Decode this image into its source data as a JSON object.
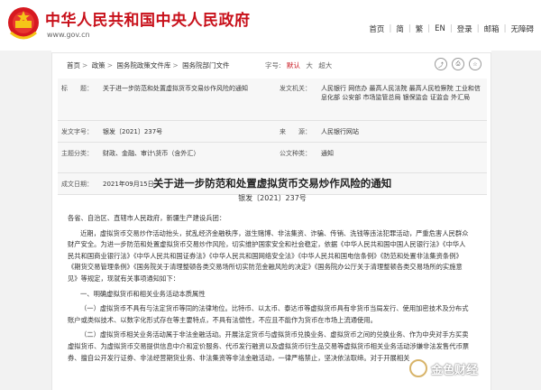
{
  "header": {
    "site_title": "中华人民共和国中央人民政府",
    "site_url": "www.gov.cn",
    "nav": [
      "首页",
      "简",
      "繁",
      "EN",
      "登录",
      "邮箱",
      "无障碍"
    ],
    "colors": {
      "brand": "#c8101a",
      "side_bg": "#f2f2f2"
    }
  },
  "breadcrumb": [
    "首页",
    "政策",
    "国务院政策文件库",
    "国务院部门文件"
  ],
  "font_size": {
    "label": "字号:",
    "options": [
      "默认",
      "大",
      "超大"
    ],
    "selected": "默认"
  },
  "toolbar_icons": [
    "share-icon",
    "print-icon",
    "favorite-icon"
  ],
  "meta": {
    "title_label": "标　　题：",
    "title": "关于进一步防范和处置虚拟货币交易炒作风险的通知",
    "issuer_label": "发文机关：",
    "issuer": "人民银行 网信办 最高人民法院 最高人民检察院 工业和信息化部 公安部 市场监管总局 银保监会 证监会 外汇局",
    "doc_no_label": "发文字号：",
    "doc_no": "银发〔2021〕237号",
    "source_label": "来　　源：",
    "source": "人民银行网站",
    "category_label": "主题分类：",
    "category": "财政、金融、审计\\货币（含外汇）",
    "type_label": "公文种类：",
    "type": "通知",
    "date_label": "成文日期：",
    "date": "2021年09月15日"
  },
  "doc": {
    "title": "关于进一步防范和处置虚拟货币交易炒作风险的通知",
    "number": "银发〔2021〕237号",
    "salutation": "各省、自治区、直辖市人民政府，新疆生产建设兵团：",
    "para1": "近期，虚拟货币交易炒作活动抬头，扰乱经济金融秩序，滋生赌博、非法集资、诈骗、传销、洗钱等违法犯罪活动，严重危害人民群众财产安全。为进一步防范和处置虚拟货币交易炒作风险，切实维护国家安全和社会稳定，依据《中华人民共和国中国人民银行法》《中华人民共和国商业银行法》《中华人民共和国证券法》《中华人民共和国网络安全法》《中华人民共和国电信条例》《防范和处置非法集资条例》《期货交易管理条例》《国务院关于清理整顿各类交易场所切实防范金融风险的决定》《国务院办公厅关于清理整顿各类交易场所的实施意见》等规定，现就有关事项通知如下：",
    "section1": "一、明确虚拟货币和相关业务活动本质属性",
    "para2": "（一）虚拟货币不具有与法定货币等同的法律地位。比特币、以太币、泰达币等虚拟货币具有非货币当局发行、使用加密技术及分布式账户或类似技术、以数字化形式存在等主要特点，不具有法偿性，不应且不能作为货币在市场上流通使用。",
    "para3": "（二）虚拟货币相关业务活动属于非法金融活动。开展法定货币与虚拟货币兑换业务、虚拟货币之间的兑换业务、作为中央对手方买卖虚拟货币、为虚拟货币交易提供信息中介和定价服务、代币发行融资以及虚拟货币衍生品交易等虚拟货币相关业务活动涉嫌非法发售代币票券、擅自公开发行证券、非法经营期货业务、非法集资等非法金融活动，一律严格禁止，坚决依法取缔。对于开展相关"
  },
  "watermark": {
    "text": "金色财经"
  }
}
